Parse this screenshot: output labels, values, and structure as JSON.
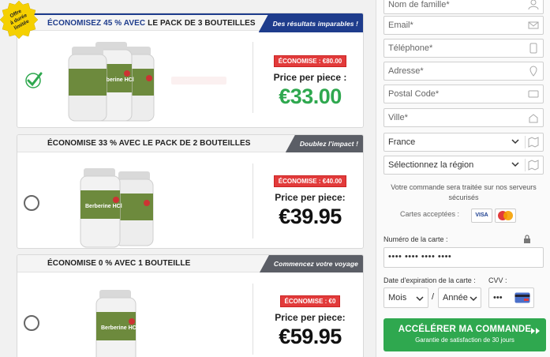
{
  "seal": {
    "text_lines": [
      "Offre",
      "à durée",
      "limitée"
    ]
  },
  "offers": [
    {
      "header_prefix": "ÉCONOMISEZ 45 % AVEC",
      "header_suffix": " LE PACK DE 3 BOUTEILLES",
      "ribbon": "Des résultats imparables !",
      "selected": true,
      "savings": "ÉCONOMISE : €80.00",
      "price_label": "Price per piece :",
      "price": "€33.00",
      "bottle_label": "Berberine HCl"
    },
    {
      "header": "ÉCONOMISE 33 % AVEC LE PACK DE 2 BOUTEILLES",
      "ribbon": "Doublez l'impact !",
      "selected": false,
      "savings": "ÉCONOMISE : €40.00",
      "price_label": "Price per piece:",
      "price": "€39.95",
      "bottle_label": "Berberine HCl"
    },
    {
      "header": "ÉCONOMISE 0 % AVEC 1 BOUTEILLE",
      "ribbon": "Commencez votre voyage",
      "selected": false,
      "savings": "ÉCONOMISE : €0",
      "price_label": "Price per piece:",
      "price": "€59.95",
      "bottle_label": "Berberine HCl"
    }
  ],
  "form": {
    "lastname_placeholder": "Nom de famille*",
    "email_placeholder": "Email*",
    "phone_placeholder": "Téléphone*",
    "address_placeholder": "Adresse*",
    "postal_placeholder": "Postal Code*",
    "city_placeholder": "Ville*",
    "country_value": "France",
    "region_value": "Sélectionnez la région",
    "secure_note": "Votre commande sera traitée sur nos serveurs sécurisés",
    "cards_accepted": "Cartes acceptées :",
    "card_number_label": "Numéro de la carte :",
    "card_number_value": "•••• •••• •••• ••••",
    "expiry_label": "Date d'expiration de la carte :",
    "cvv_label": "CVV :",
    "month_value": "Mois",
    "slash": "/",
    "year_value": "Année",
    "cvv_value": "•••",
    "submit_label": "ACCÉLÉRER MA COMMANDE",
    "submit_sub": "Garantie de satisfaction de 30 jours"
  },
  "icons": [
    "user-icon",
    "mail-icon",
    "phone-icon",
    "pin-icon",
    "zip-icon",
    "city-icon",
    "lock-icon",
    "card-icon"
  ],
  "colors": {
    "green": "#2fa84f",
    "navy": "#1e3c8c",
    "red": "#e23b3b",
    "gray_ribbon": "#5b5e66"
  }
}
